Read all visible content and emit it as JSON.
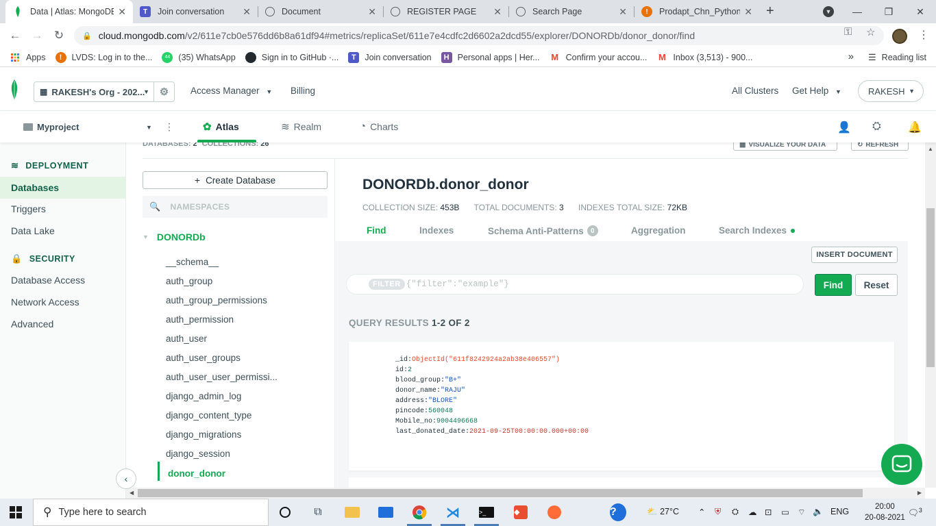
{
  "browser": {
    "tabs": [
      {
        "label": "Data | Atlas: MongoDB",
        "icon": "mongodb-leaf-icon"
      },
      {
        "label": "Join conversation",
        "icon": "teams-icon"
      },
      {
        "label": "Document",
        "icon": "globe-icon"
      },
      {
        "label": "REGISTER PAGE",
        "icon": "globe-icon"
      },
      {
        "label": "Search Page",
        "icon": "globe-icon"
      },
      {
        "label": "Prodapt_Chn_Python_",
        "icon": "orange-info-icon"
      }
    ],
    "url_host": "cloud.mongodb.com",
    "url_path": "/v2/611e7cb0e576dd6b8a61df94#metrics/replicaSet/611e7e4cdfc2d6602a2dcd55/explorer/DONORDb/donor_donor/find",
    "bookmarks": [
      {
        "label": "Apps",
        "icon": "apps-grid-icon"
      },
      {
        "label": "LVDS: Log in to the...",
        "icon": "orange-info-icon"
      },
      {
        "label": "(35) WhatsApp",
        "icon": "whatsapp-icon"
      },
      {
        "label": "Sign in to GitHub ·...",
        "icon": "github-icon"
      },
      {
        "label": "Join conversation",
        "icon": "teams-icon"
      },
      {
        "label": "Personal apps | Her...",
        "icon": "heroku-icon"
      },
      {
        "label": "Confirm your accou...",
        "icon": "gmail-icon"
      },
      {
        "label": "Inbox (3,513) - 900...",
        "icon": "gmail-icon"
      }
    ],
    "reading_list": "Reading list"
  },
  "atlas_nav": {
    "org": "RAKESH's Org - 202...",
    "access_manager": "Access Manager",
    "billing": "Billing",
    "all_clusters": "All Clusters",
    "get_help": "Get Help",
    "user": "RAKESH"
  },
  "project_bar": {
    "project": "Myproject",
    "tabs": [
      "Atlas",
      "Realm",
      "Charts"
    ],
    "active_tab": "Atlas"
  },
  "sidebar": {
    "deployment_header": "DEPLOYMENT",
    "deployment_items": [
      "Databases",
      "Triggers",
      "Data Lake"
    ],
    "active_item": "Databases",
    "security_header": "SECURITY",
    "security_items": [
      "Database Access",
      "Network Access",
      "Advanced"
    ]
  },
  "explorer": {
    "databases_label": "DATABASES:",
    "databases_count": "2",
    "collections_label": "COLLECTIONS:",
    "collections_count": "26",
    "visualize_btn": "VISUALIZE YOUR DATA",
    "refresh_btn": "REFRESH",
    "create_db": "Create Database",
    "ns_placeholder": "NAMESPACES",
    "db_name": "DONORDb",
    "collections": [
      "__schema__",
      "auth_group",
      "auth_group_permissions",
      "auth_permission",
      "auth_user",
      "auth_user_groups",
      "auth_user_user_permissi...",
      "django_admin_log",
      "django_content_type",
      "django_migrations",
      "django_session"
    ],
    "active_collection": "donor_donor"
  },
  "collection": {
    "title": "DONORDb.donor_donor",
    "size_label": "COLLECTION SIZE:",
    "size": "453B",
    "docs_label": "TOTAL DOCUMENTS:",
    "docs": "3",
    "idx_label": "INDEXES TOTAL SIZE:",
    "idx": "72KB",
    "tabs": {
      "find": "Find",
      "indexes": "Indexes",
      "schema": "Schema Anti-Patterns",
      "schema_count": "0",
      "aggregation": "Aggregation",
      "search": "Search Indexes"
    },
    "insert_btn": "INSERT DOCUMENT",
    "filter_pill": "FILTER",
    "filter_placeholder": "{\"filter\":\"example\"}",
    "find_btn": "Find",
    "reset_btn": "Reset",
    "results_label": "QUERY RESULTS",
    "results_range": "1-2 OF 2"
  },
  "document": {
    "fields": [
      {
        "key": "_id:",
        "value": "ObjectId(\"611f8242924a2ab38e406557\")",
        "type": "oid"
      },
      {
        "key": "id:",
        "value": "2",
        "type": "num"
      },
      {
        "key": "blood_group:",
        "value": "\"B+\"",
        "type": "str"
      },
      {
        "key": "donor_name:",
        "value": "\"RAJU\"",
        "type": "str"
      },
      {
        "key": "address:",
        "value": "\"BLORE\"",
        "type": "str"
      },
      {
        "key": "pincode:",
        "value": "560048",
        "type": "num"
      },
      {
        "key": "Mobile_no:",
        "value": "9004496668",
        "type": "num"
      },
      {
        "key": "last_donated_date:",
        "value": "2021-09-25T00:00:00.000+00:00",
        "type": "date"
      }
    ]
  },
  "taskbar": {
    "search_placeholder": "Type here to search",
    "weather": "27°C",
    "lang": "ENG",
    "time": "20:00",
    "date": "20-08-2021",
    "notif_count": "3"
  },
  "colors": {
    "accent": "#13aa52",
    "dark_green": "#116149"
  }
}
